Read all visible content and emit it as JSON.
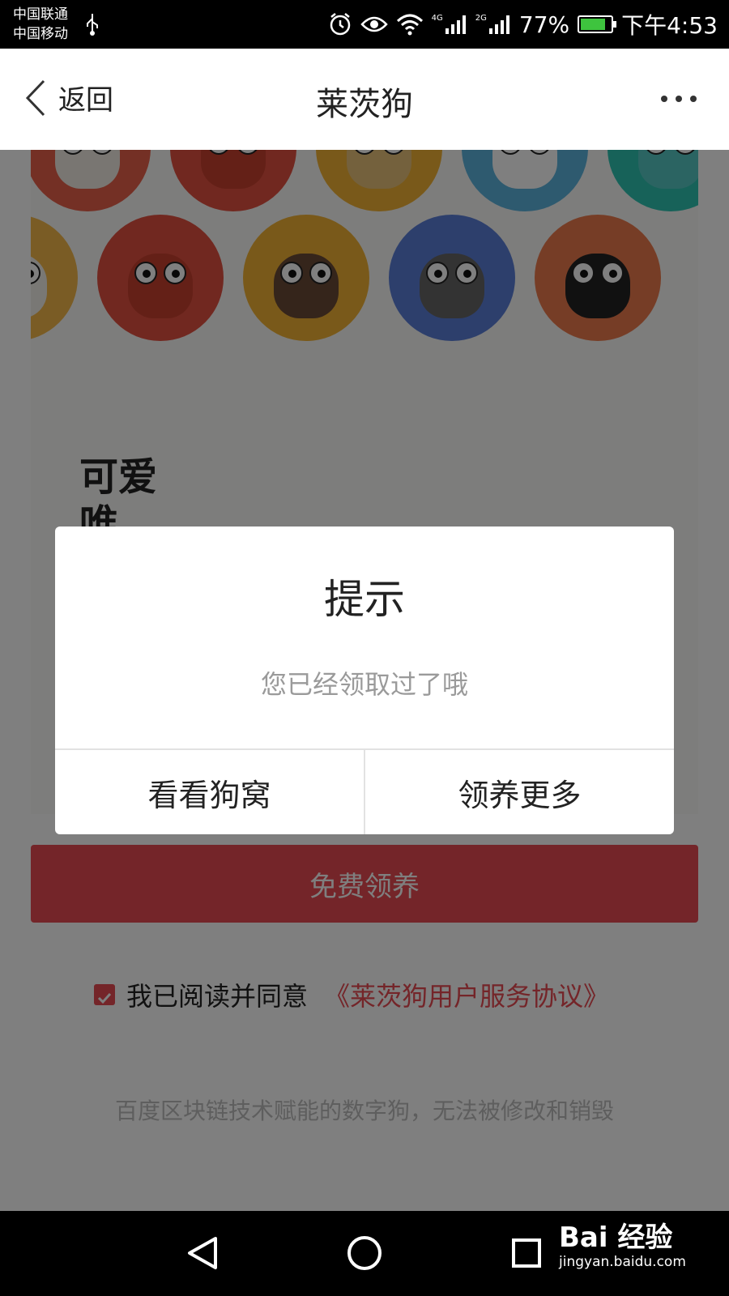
{
  "status_bar": {
    "carrier_1": "中国联通",
    "carrier_2": "中国移动",
    "network_1": "4G",
    "network_2": "2G",
    "battery": "77%",
    "time": "下午4:53",
    "icons": [
      "usb-icon",
      "alarm-icon",
      "eye-icon",
      "wifi-icon",
      "signal-icon",
      "battery-icon"
    ]
  },
  "header": {
    "back_label": "返回",
    "title": "莱茨狗",
    "more_icon": "more-icon"
  },
  "content": {
    "card_heading": "可爱",
    "card_heading_partial": "唯",
    "avatars": [
      {
        "color": "#e8604a",
        "face": "#f2ece4"
      },
      {
        "color": "#e25140",
        "face": "#c8402e"
      },
      {
        "color": "#f2b335",
        "face": "#e9c27a"
      },
      {
        "color": "#5cb4de",
        "face": "#ffffff"
      },
      {
        "color": "#2fc4b2",
        "face": "#56c9c4"
      },
      {
        "color": "#f4b94a",
        "face": "#f3f0ea"
      },
      {
        "color": "#e25140",
        "face": "#c8402e"
      },
      {
        "color": "#f2b335",
        "face": "#6b4a36"
      },
      {
        "color": "#5b7fd9",
        "face": "#676767"
      },
      {
        "color": "#ec7b4d",
        "face": "#222222"
      }
    ],
    "free_button": "免费领养",
    "agree_text": "我已阅读并同意",
    "agree_link": "《莱茨狗用户服务协议》",
    "footer_note": "百度区块链技术赋能的数字狗，无法被修改和销毁"
  },
  "dialog": {
    "title": "提示",
    "message": "您已经领取过了哦",
    "left_button": "看看狗窝",
    "right_button": "领养更多"
  },
  "nav_bar": {
    "watermark_brand": "Bai 经验",
    "watermark_url": "jingyan.baidu.com"
  },
  "colors": {
    "accent": "#e84a52",
    "mask": "rgba(0,0,0,0.5)"
  }
}
